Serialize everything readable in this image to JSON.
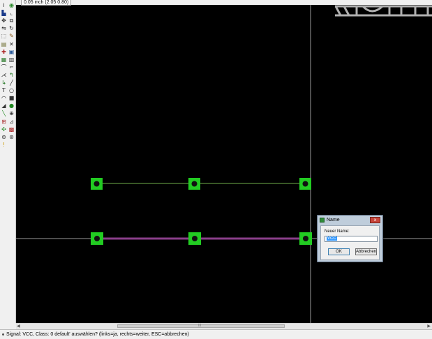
{
  "coordinate_readout": "0.05 inch (2.05 0.80)",
  "status": {
    "message": "Signal: VCC, Class: 0 default' auswählen? (links=ja, rechts=weiter, ESC=abbrechen)"
  },
  "dialog": {
    "title": "Name",
    "field_label": "Neuer Name:",
    "field_value": "VCC",
    "ok_label": "OK",
    "cancel_label": "Abbrechen",
    "close_glyph": "x"
  },
  "scrollbar": {
    "left_arrow": "◀",
    "right_arrow": "▶",
    "grip": "III"
  },
  "colors": {
    "canvas_background": "#000000",
    "pad": "#22cc22",
    "pad_hole": "#111111",
    "trace_top": "#6fae4a",
    "trace_selected": "#8a3e8a",
    "crosshair": "#9a9a9a",
    "frame": "#b0b0b0"
  },
  "tools": [
    {
      "name": "info-icon",
      "glyph": "i",
      "color": "#222222"
    },
    {
      "name": "show-icon",
      "glyph": "◉",
      "color": "#2a8a2a"
    },
    {
      "name": "display-layers-icon",
      "glyph": "▙",
      "color": "#1a3a8a"
    },
    {
      "name": "mark-icon",
      "glyph": "⌞",
      "color": "#333333"
    },
    {
      "name": "move-icon",
      "glyph": "✥",
      "color": "#222222"
    },
    {
      "name": "copy-icon",
      "glyph": "⧉",
      "color": "#333333"
    },
    {
      "name": "mirror-icon",
      "glyph": "⇋",
      "color": "#222222"
    },
    {
      "name": "rotate-icon",
      "glyph": "↻",
      "color": "#222222"
    },
    {
      "name": "group-icon",
      "glyph": "⬚",
      "color": "#444444"
    },
    {
      "name": "change-icon",
      "glyph": "✎",
      "color": "#8a5a1a"
    },
    {
      "name": "paste-icon",
      "glyph": "▤",
      "color": "#6a6a2a"
    },
    {
      "name": "delete-icon",
      "glyph": "✕",
      "color": "#222222"
    },
    {
      "name": "add-icon",
      "glyph": "✚",
      "color": "#aa2222"
    },
    {
      "name": "name-icon",
      "glyph": "▣",
      "color": "#2a5a9a"
    },
    {
      "name": "value-icon",
      "glyph": "▦",
      "color": "#2a7a2a"
    },
    {
      "name": "smash-icon",
      "glyph": "▥",
      "color": "#333333"
    },
    {
      "name": "miter-icon",
      "glyph": "⌒",
      "color": "#222222"
    },
    {
      "name": "split-icon",
      "glyph": "⌐",
      "color": "#333333"
    },
    {
      "name": "optimize-icon",
      "glyph": "⋌",
      "color": "#222222"
    },
    {
      "name": "route-icon",
      "glyph": "↰",
      "color": "#227722"
    },
    {
      "name": "ripup-icon",
      "glyph": "↳",
      "color": "#227722"
    },
    {
      "name": "wire-icon",
      "glyph": "╱",
      "color": "#222222"
    },
    {
      "name": "text-icon",
      "glyph": "T",
      "color": "#222222"
    },
    {
      "name": "circle-icon",
      "glyph": "○",
      "color": "#222222"
    },
    {
      "name": "arc-icon",
      "glyph": "◠",
      "color": "#222222"
    },
    {
      "name": "rect-icon",
      "glyph": "■",
      "color": "#333333"
    },
    {
      "name": "polygon-icon",
      "glyph": "◢",
      "color": "#333333"
    },
    {
      "name": "via-icon",
      "glyph": "●",
      "color": "#228822"
    },
    {
      "name": "signal-icon",
      "glyph": "╲",
      "color": "#228822"
    },
    {
      "name": "hole-icon",
      "glyph": "⊕",
      "color": "#222222"
    },
    {
      "name": "attribute-icon",
      "glyph": "⊞",
      "color": "#aa3333"
    },
    {
      "name": "dimension-icon",
      "glyph": "⊿",
      "color": "#333333"
    },
    {
      "name": "ratsnest-icon",
      "glyph": "✣",
      "color": "#228822"
    },
    {
      "name": "auto-icon",
      "glyph": "▩",
      "color": "#aa2222"
    },
    {
      "name": "erc-icon",
      "glyph": "⊜",
      "color": "#333333"
    },
    {
      "name": "drc-icon",
      "glyph": "⊛",
      "color": "#333333"
    },
    {
      "name": "errors-icon",
      "glyph": "!",
      "color": "#cc9900"
    }
  ]
}
